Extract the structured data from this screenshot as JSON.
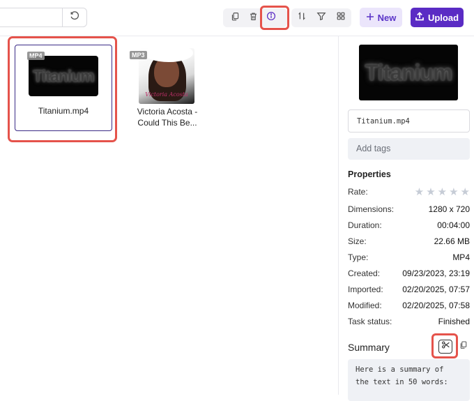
{
  "toolbar": {
    "search_placeholder": "",
    "new_label": "New",
    "upload_label": "Upload"
  },
  "files": [
    {
      "name": "Titanium.mp4",
      "badge": "MP4",
      "thumb_text": "Titanium"
    },
    {
      "name_line1": "Victoria Acosta -",
      "name_line2": "Could This Be...",
      "badge": "MP3",
      "thumb_text": "Victoria Acosta"
    }
  ],
  "panel": {
    "preview_text": "Titanium",
    "filename": "Titanium.mp4",
    "tags_placeholder": "Add tags",
    "properties_title": "Properties",
    "rate_label": "Rate:",
    "rating": 0,
    "properties": [
      {
        "key": "Dimensions:",
        "value": "1280 x 720"
      },
      {
        "key": "Duration:",
        "value": "00:04:00"
      },
      {
        "key": "Size:",
        "value": "22.66 MB"
      },
      {
        "key": "Type:",
        "value": "MP4"
      },
      {
        "key": "Created:",
        "value": "09/23/2023, 23:19"
      },
      {
        "key": "Imported:",
        "value": "02/20/2025, 07:57"
      },
      {
        "key": "Modified:",
        "value": "02/20/2025, 07:58"
      },
      {
        "key": "Task status:",
        "value": "Finished"
      }
    ],
    "summary_title": "Summary",
    "summary_line1": "Here is a summary of",
    "summary_line2": "the text in 50 words:"
  },
  "colors": {
    "accent": "#5a2bc4",
    "accent_light": "#ebe5fb",
    "highlight": "#e5534b"
  },
  "icons": [
    "refresh-icon",
    "copy-icon",
    "trash-icon",
    "info-icon",
    "sort-icon",
    "filter-icon",
    "grid-icon",
    "plus-icon",
    "upload-icon",
    "star-icon",
    "scissors-icon"
  ]
}
